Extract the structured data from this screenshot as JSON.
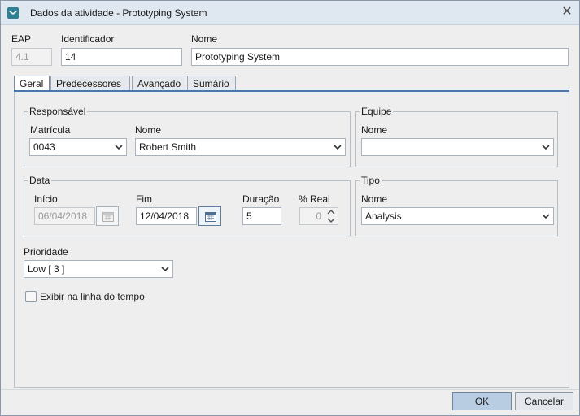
{
  "window": {
    "title": "Dados da atividade - Prototyping System",
    "close_symbol": "✕"
  },
  "header": {
    "eap_label": "EAP",
    "eap_value": "4.1",
    "id_label": "Identificador",
    "id_value": "14",
    "name_label": "Nome",
    "name_value": "Prototyping System"
  },
  "tabs": [
    {
      "label": "Geral",
      "active": true
    },
    {
      "label": "Predecessores",
      "active": false
    },
    {
      "label": "Avançado",
      "active": false
    },
    {
      "label": "Sumário",
      "active": false
    }
  ],
  "responsavel": {
    "title": "Responsável",
    "matricula_label": "Matrícula",
    "matricula_value": "0043",
    "nome_label": "Nome",
    "nome_value": "Robert Smith"
  },
  "equipe": {
    "title": "Equipe",
    "nome_label": "Nome",
    "nome_value": ""
  },
  "data": {
    "title": "Data",
    "inicio_label": "Início",
    "inicio_value": "06/04/2018",
    "fim_label": "Fim",
    "fim_value": "12/04/2018",
    "duracao_label": "Duração",
    "duracao_value": "5",
    "real_label": "% Real",
    "real_value": "0"
  },
  "tipo": {
    "title": "Tipo",
    "nome_label": "Nome",
    "nome_value": "Analysis"
  },
  "prioridade": {
    "label": "Prioridade",
    "value": "Low [ 3 ]"
  },
  "timeline": {
    "label": "Exibir na linha do tempo",
    "checked": false
  },
  "buttons": {
    "ok": "OK",
    "cancel": "Cancelar"
  },
  "colors": {
    "accent": "#4a79a9",
    "titlebar": "#dfe7f0",
    "primary_button": "#b9cde2"
  }
}
